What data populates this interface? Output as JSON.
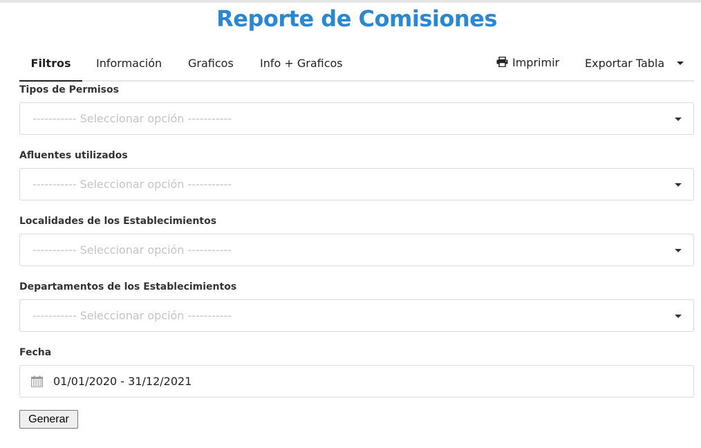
{
  "page": {
    "title": "Reporte de Comisiones"
  },
  "tabs": [
    {
      "label": "Filtros",
      "active": true
    },
    {
      "label": "Información",
      "active": false
    },
    {
      "label": "Graficos",
      "active": false
    },
    {
      "label": "Info + Graficos",
      "active": false
    }
  ],
  "toolbar": {
    "print_label": "Imprimir",
    "print_icon": "printer-icon",
    "export_label": "Exportar Tabla",
    "export_icon": "caret-down-icon"
  },
  "filters": [
    {
      "label": "Tipos de Permisos",
      "placeholder": "----------- Seleccionar opción -----------"
    },
    {
      "label": "Afluentes utilizados",
      "placeholder": "----------- Seleccionar opción -----------"
    },
    {
      "label": "Localidades de los Establecimientos",
      "placeholder": "----------- Seleccionar opción -----------"
    },
    {
      "label": "Departamentos de los Establecimientos",
      "placeholder": "----------- Seleccionar opción -----------"
    }
  ],
  "date": {
    "label": "Fecha",
    "value": "01/01/2020 - 31/12/2021",
    "icon": "calendar-icon"
  },
  "actions": {
    "generate_label": "Generar"
  },
  "colors": {
    "accent": "#2a87d0",
    "placeholder": "#c4c4c4",
    "border": "#d9d9d9"
  }
}
